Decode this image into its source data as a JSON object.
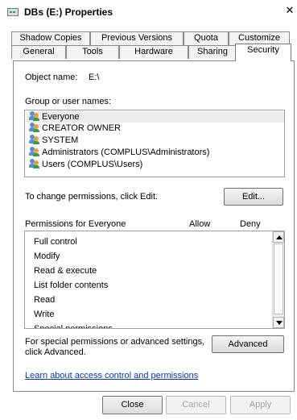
{
  "window": {
    "title": "DBs (E:) Properties",
    "close_glyph": "✕"
  },
  "tabs": {
    "row1": [
      "Shadow Copies",
      "Previous Versions",
      "Quota",
      "Customize"
    ],
    "row2": [
      "General",
      "Tools",
      "Hardware",
      "Sharing",
      "Security"
    ],
    "active": "Security"
  },
  "security": {
    "object_name_label": "Object name:",
    "object_name_value": "E:\\",
    "group_label": "Group or user names:",
    "users": [
      "Everyone",
      "CREATOR OWNER",
      "SYSTEM",
      "Administrators (COMPLUS\\Administrators)",
      "Users (COMPLUS\\Users)"
    ],
    "selected_user": "Everyone",
    "change_hint": "To change permissions, click Edit.",
    "edit_button": "Edit...",
    "permissions_header": "Permissions for Everyone",
    "allow_header": "Allow",
    "deny_header": "Deny",
    "permissions": [
      "Full control",
      "Modify",
      "Read & execute",
      "List folder contents",
      "Read",
      "Write",
      "Special permissions"
    ],
    "special_hint": "For special permissions or advanced settings, click Advanced.",
    "advanced_button": "Advanced",
    "learn_link": "Learn about access control and permissions"
  },
  "footer": {
    "close": "Close",
    "cancel": "Cancel",
    "apply": "Apply"
  },
  "icons": {
    "window_icon": "drive-icon",
    "user_icon": "user-group-icon",
    "scroll_up": "arrow-up-icon",
    "scroll_down": "arrow-down-icon"
  }
}
